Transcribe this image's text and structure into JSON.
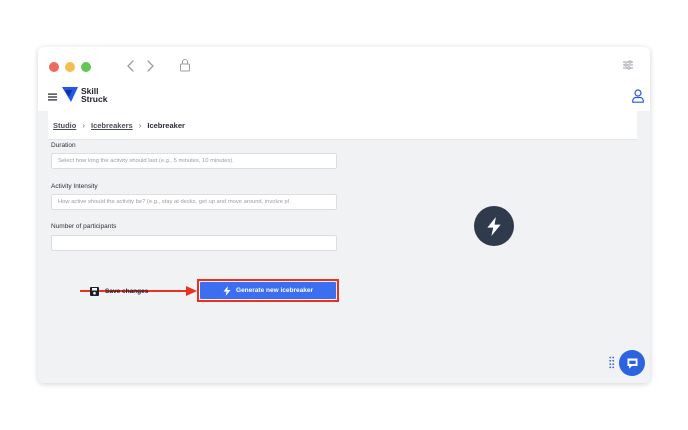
{
  "window": {
    "traffic_lights": [
      "close",
      "minimize",
      "maximize"
    ]
  },
  "app": {
    "logo_line1": "Skill",
    "logo_line2": "Struck"
  },
  "breadcrumb": {
    "items": [
      "Studio",
      "Icebreakers"
    ],
    "current": "Icebreaker"
  },
  "form": {
    "duration": {
      "label": "Duration",
      "placeholder": "Select how long the activity should last (e.g., 5 minutes, 10 minutes)."
    },
    "intensity": {
      "label": "Activity Intensity",
      "placeholder": "How active should the activity be? (e.g., stay at desks, get up and move around, involve pl"
    },
    "participants": {
      "label": "Number of participants",
      "placeholder": ""
    }
  },
  "actions": {
    "save_label": "Save changes",
    "generate_label": "Generate new icebreaker"
  },
  "colors": {
    "accent": "#3b6ef0",
    "highlight": "#e8321e",
    "badge": "#2f3a4d",
    "chat": "#2d62e0"
  },
  "icons": [
    "hamburger-icon",
    "user-icon",
    "lock-icon",
    "sliders-icon",
    "bolt-icon",
    "save-icon",
    "chat-icon",
    "grip-icon"
  ]
}
